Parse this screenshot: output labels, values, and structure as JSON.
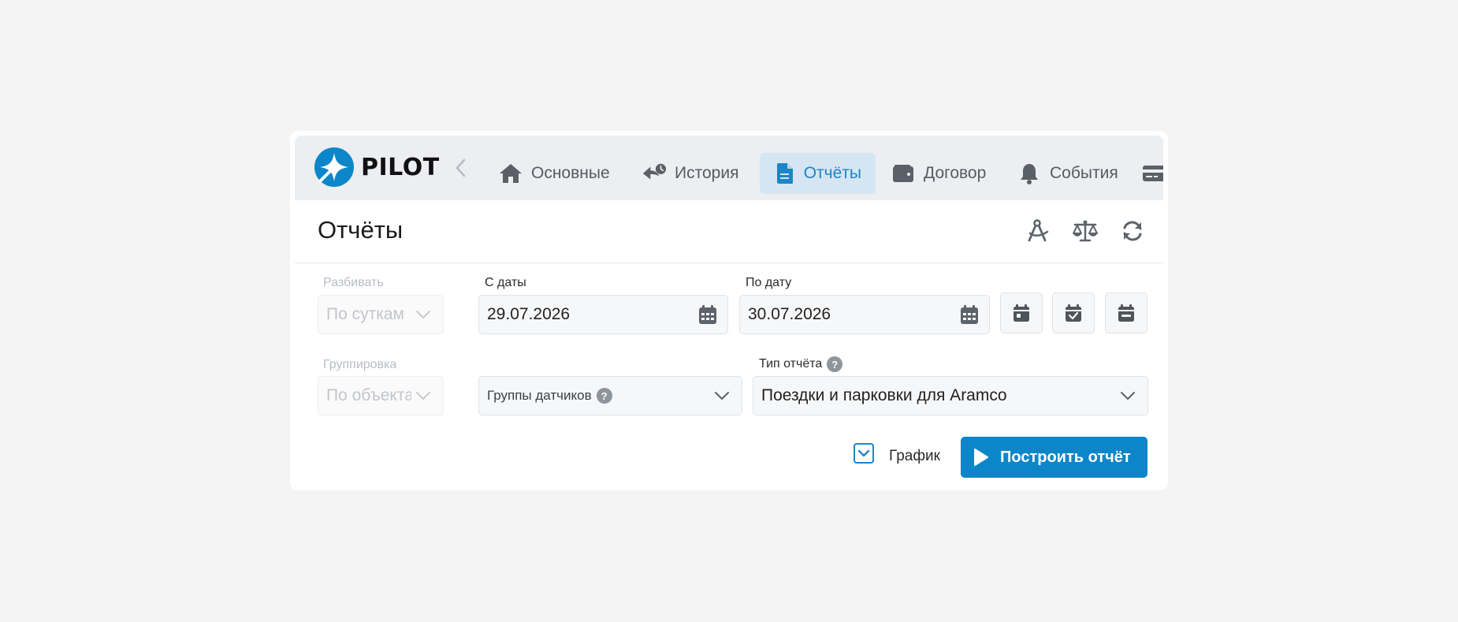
{
  "brand": {
    "name": "PILOT",
    "color": "#0d86c9"
  },
  "nav": {
    "back_icon": "chevron-left-icon",
    "items": [
      {
        "label": "Основные",
        "icon": "home-icon",
        "active": false
      },
      {
        "label": "История",
        "icon": "history-icon",
        "active": false
      },
      {
        "label": "Отчёты",
        "icon": "document-icon",
        "active": true
      },
      {
        "label": "Договор",
        "icon": "wallet-icon",
        "active": false
      },
      {
        "label": "События",
        "icon": "bell-icon",
        "active": false
      },
      {
        "label": "",
        "icon": "credit-card-icon",
        "active": false
      }
    ]
  },
  "page": {
    "title": "Отчёты",
    "actions": [
      {
        "icon": "compass-icon"
      },
      {
        "icon": "scales-icon"
      },
      {
        "icon": "refresh-icon"
      }
    ]
  },
  "form": {
    "split": {
      "label": "Разбивать",
      "value": "По суткам",
      "disabled": true
    },
    "date_from": {
      "label": "С даты",
      "value": "29.07.2026"
    },
    "date_to": {
      "label": "По дату",
      "value": "30.07.2026"
    },
    "quick_dates": [
      {
        "icon": "calendar-day-icon"
      },
      {
        "icon": "calendar-check-icon"
      },
      {
        "icon": "calendar-minus-icon"
      }
    ],
    "grouping": {
      "label": "Группировка",
      "value": "По объектам",
      "disabled": true
    },
    "sensor_groups": {
      "placeholder": "Группы датчиков",
      "help": "?"
    },
    "report_type": {
      "label": "Тип отчёта",
      "help": "?",
      "value": "Поездки и парковки для Aramco"
    },
    "chart_checkbox": {
      "label": "График",
      "checked": true
    },
    "build_button": {
      "label": "Построить отчёт"
    }
  },
  "colors": {
    "accent": "#1e84c7",
    "nav_bg": "#eceef1",
    "active_bg": "#d5e5f1"
  }
}
